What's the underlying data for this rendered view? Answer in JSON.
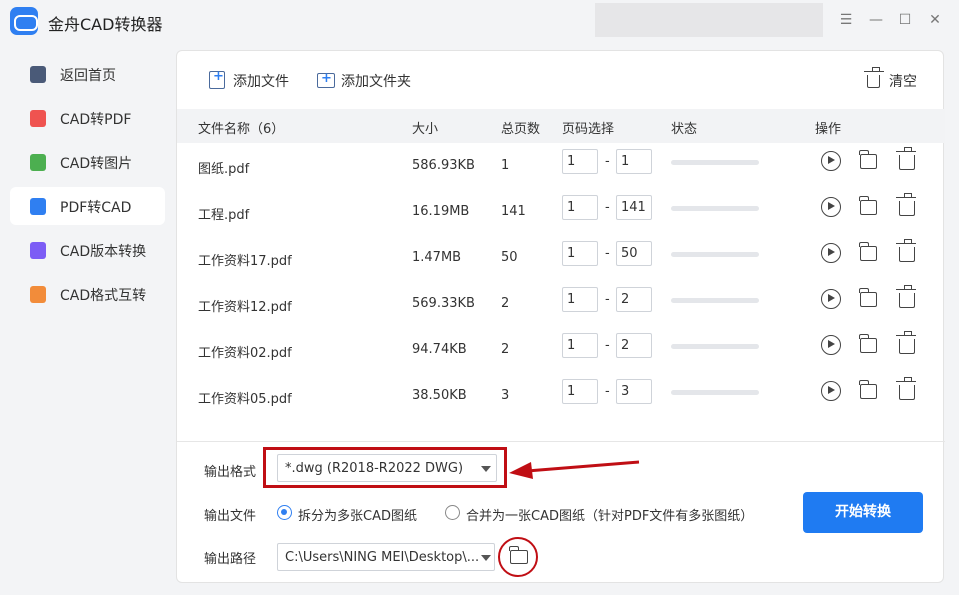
{
  "app": {
    "title": "金舟CAD转换器"
  },
  "window_controls": {
    "menu": "☰",
    "minimize": "—",
    "maximize": "☐",
    "close": "✕"
  },
  "sidebar": {
    "items": [
      {
        "label": "返回首页",
        "icon": "home-icon",
        "color": "#4a5a78"
      },
      {
        "label": "CAD转PDF",
        "icon": "pdf-file-icon",
        "color": "#ef5350"
      },
      {
        "label": "CAD转图片",
        "icon": "image-file-icon",
        "color": "#4caf50"
      },
      {
        "label": "PDF转CAD",
        "icon": "cad-file-icon",
        "color": "#2f7ff1",
        "active": true
      },
      {
        "label": "CAD版本转换",
        "icon": "ai-file-icon",
        "color": "#7c5cf5"
      },
      {
        "label": "CAD格式互转",
        "icon": "convert-file-icon",
        "color": "#f28c3a"
      }
    ]
  },
  "toolbar": {
    "add_file": "添加文件",
    "add_folder": "添加文件夹",
    "clear": "清空"
  },
  "table": {
    "headers": {
      "name": "文件名称（6）",
      "size": "大小",
      "pages": "总页数",
      "page_select": "页码选择",
      "status": "状态",
      "actions": "操作"
    },
    "rows": [
      {
        "name": "图纸.pdf",
        "size": "586.93KB",
        "pages": "1",
        "from": "1",
        "to": "1"
      },
      {
        "name": "工程.pdf",
        "size": "16.19MB",
        "pages": "141",
        "from": "1",
        "to": "141"
      },
      {
        "name": "工作资料17.pdf",
        "size": "1.47MB",
        "pages": "50",
        "from": "1",
        "to": "50"
      },
      {
        "name": "工作资料12.pdf",
        "size": "569.33KB",
        "pages": "2",
        "from": "1",
        "to": "2"
      },
      {
        "name": "工作资料02.pdf",
        "size": "94.74KB",
        "pages": "2",
        "from": "1",
        "to": "2"
      },
      {
        "name": "工作资料05.pdf",
        "size": "38.50KB",
        "pages": "3",
        "from": "1",
        "to": "3"
      }
    ],
    "separator": "-"
  },
  "output": {
    "format_label": "输出格式",
    "format_value": "*.dwg (R2018-R2022 DWG)",
    "file_label": "输出文件",
    "option_split": "拆分为多张CAD图纸",
    "option_merge": "合并为一张CAD图纸（针对PDF文件有多张图纸）",
    "path_label": "输出路径",
    "path_value": "C:\\Users\\NING MEI\\Desktop\\...",
    "start_button": "开始转换"
  },
  "accent_color": "#1f7bf2",
  "annotation_color": "#c00e14"
}
